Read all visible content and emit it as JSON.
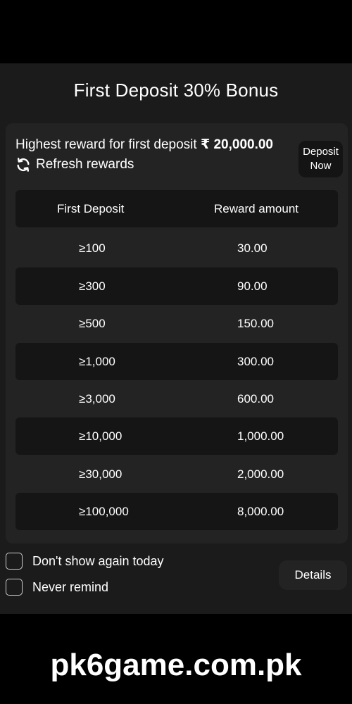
{
  "modal": {
    "title": "First Deposit 30% Bonus",
    "highest_prefix": "Highest reward for first deposit ",
    "currency_symbol": "₹",
    "highest_amount": "20,000.00",
    "refresh_label": "Refresh rewards",
    "deposit_button_line1": "Deposit",
    "deposit_button_line2": "Now"
  },
  "table": {
    "headers": [
      "First Deposit",
      "Reward amount"
    ],
    "rows": [
      {
        "deposit": "≥100",
        "reward": "30.00"
      },
      {
        "deposit": "≥300",
        "reward": "90.00"
      },
      {
        "deposit": "≥500",
        "reward": "150.00"
      },
      {
        "deposit": "≥1,000",
        "reward": "300.00"
      },
      {
        "deposit": "≥3,000",
        "reward": "600.00"
      },
      {
        "deposit": "≥10,000",
        "reward": "1,000.00"
      },
      {
        "deposit": "≥30,000",
        "reward": "2,000.00"
      },
      {
        "deposit": "≥100,000",
        "reward": "8,000.00"
      }
    ]
  },
  "options": {
    "dont_show_today": "Don't show again today",
    "never_remind": "Never remind",
    "details_label": "Details"
  },
  "watermark": "pk6game.com.pk",
  "icons": {
    "refresh": "refresh-icon"
  },
  "colors": {
    "background": "#000000",
    "modal": "#1b1b1b",
    "card": "#232323",
    "row_shade": "#151515",
    "text": "#ffffff"
  }
}
